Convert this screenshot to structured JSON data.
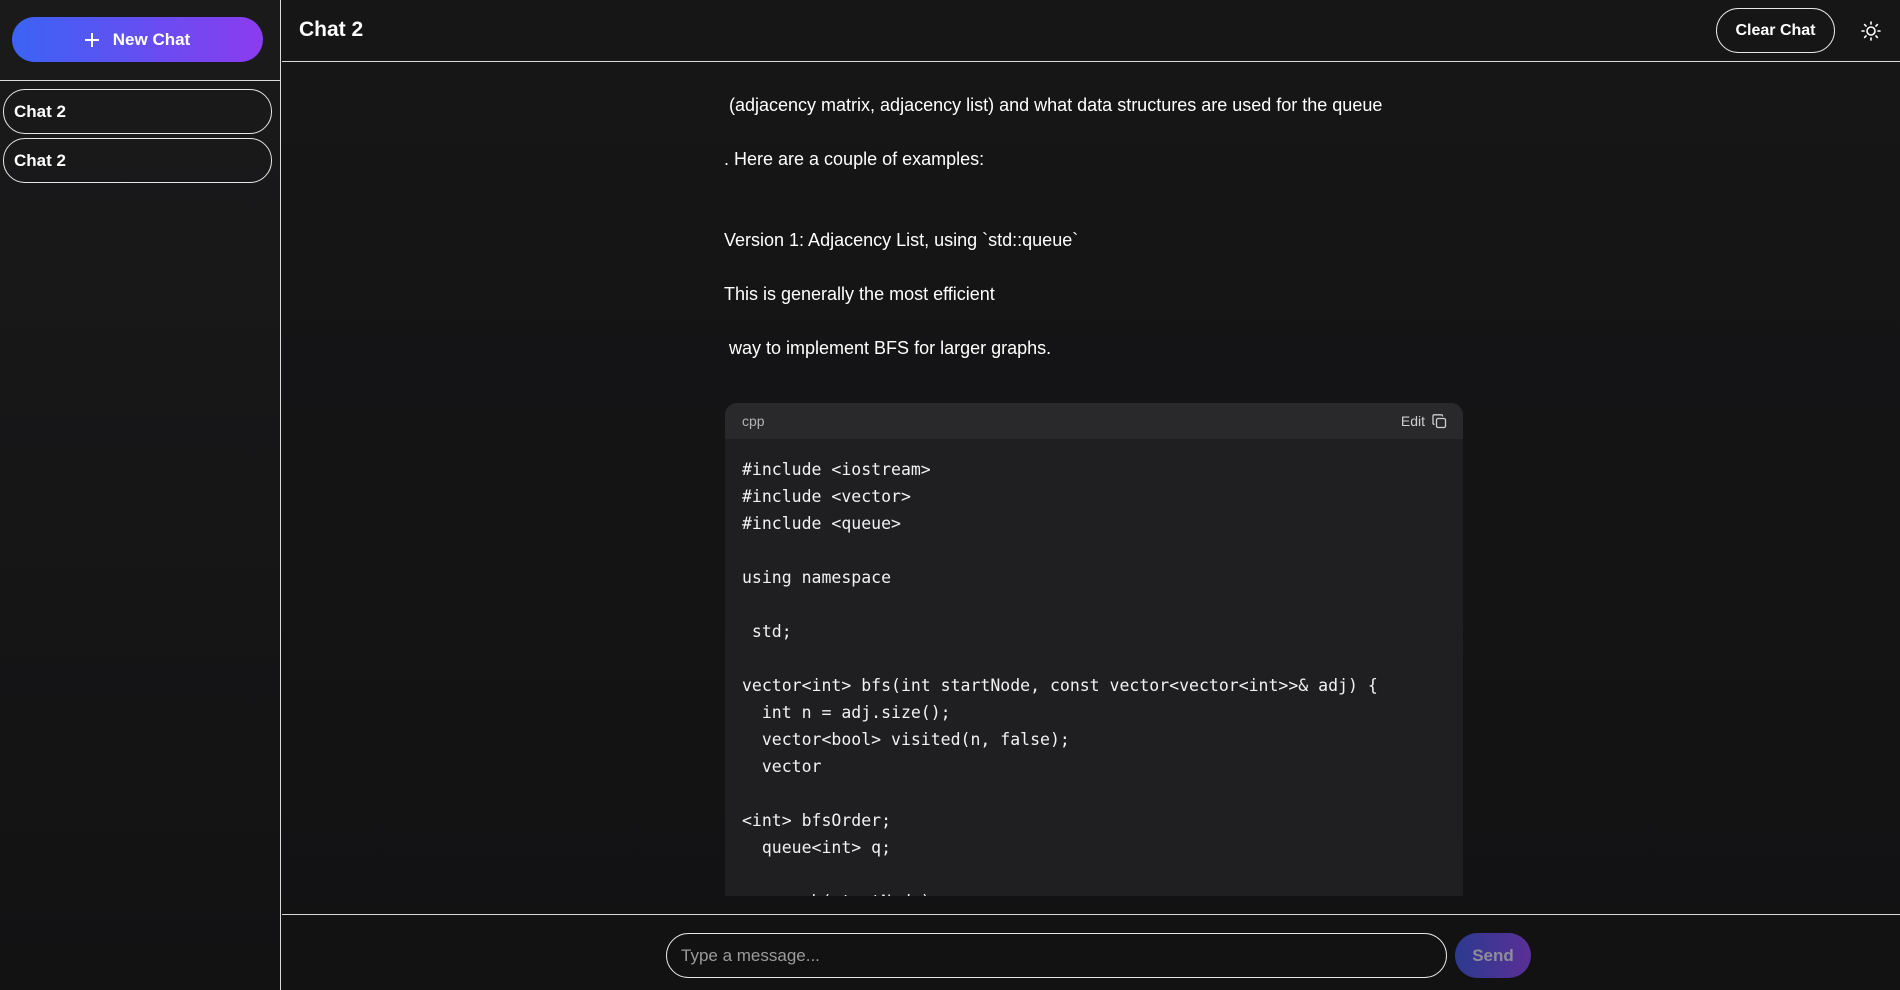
{
  "sidebar": {
    "new_chat_label": "New Chat",
    "chats": [
      {
        "label": "Chat 2"
      },
      {
        "label": "Chat 2"
      }
    ]
  },
  "header": {
    "title": "Chat 2",
    "clear_label": "Clear Chat",
    "theme_icon": "sun-icon"
  },
  "conversation": {
    "lines": [
      " (adjacency matrix, adjacency list) and what data structures are used for the queue",
      ". Here are a couple of examples:",
      "Version 1: Adjacency List, using `std::queue`",
      "This is generally the most efficient",
      " way to implement BFS for larger graphs."
    ],
    "code": {
      "language": "cpp",
      "edit_label": "Edit",
      "copy_icon": "copy-icon",
      "content": "#include <iostream>\n#include <vector>\n#include <queue>\n\nusing namespace\n\n std;\n\nvector<int> bfs(int startNode, const vector<vector<int>>& adj) {\n  int n = adj.size();\n  vector<bool> visited(n, false);\n  vector\n\n<int> bfsOrder;\n  queue<int> q;\n\n  q.push(startNode);"
    }
  },
  "composer": {
    "placeholder": "Type a message...",
    "value": "",
    "send_label": "Send"
  },
  "colors": {
    "background": "#141416",
    "accent_gradient_start": "#3b63f4",
    "accent_gradient_end": "#8b3cf0",
    "code_background": "#1f1f22",
    "code_header": "#29292c",
    "border": "#e6e6e6"
  }
}
